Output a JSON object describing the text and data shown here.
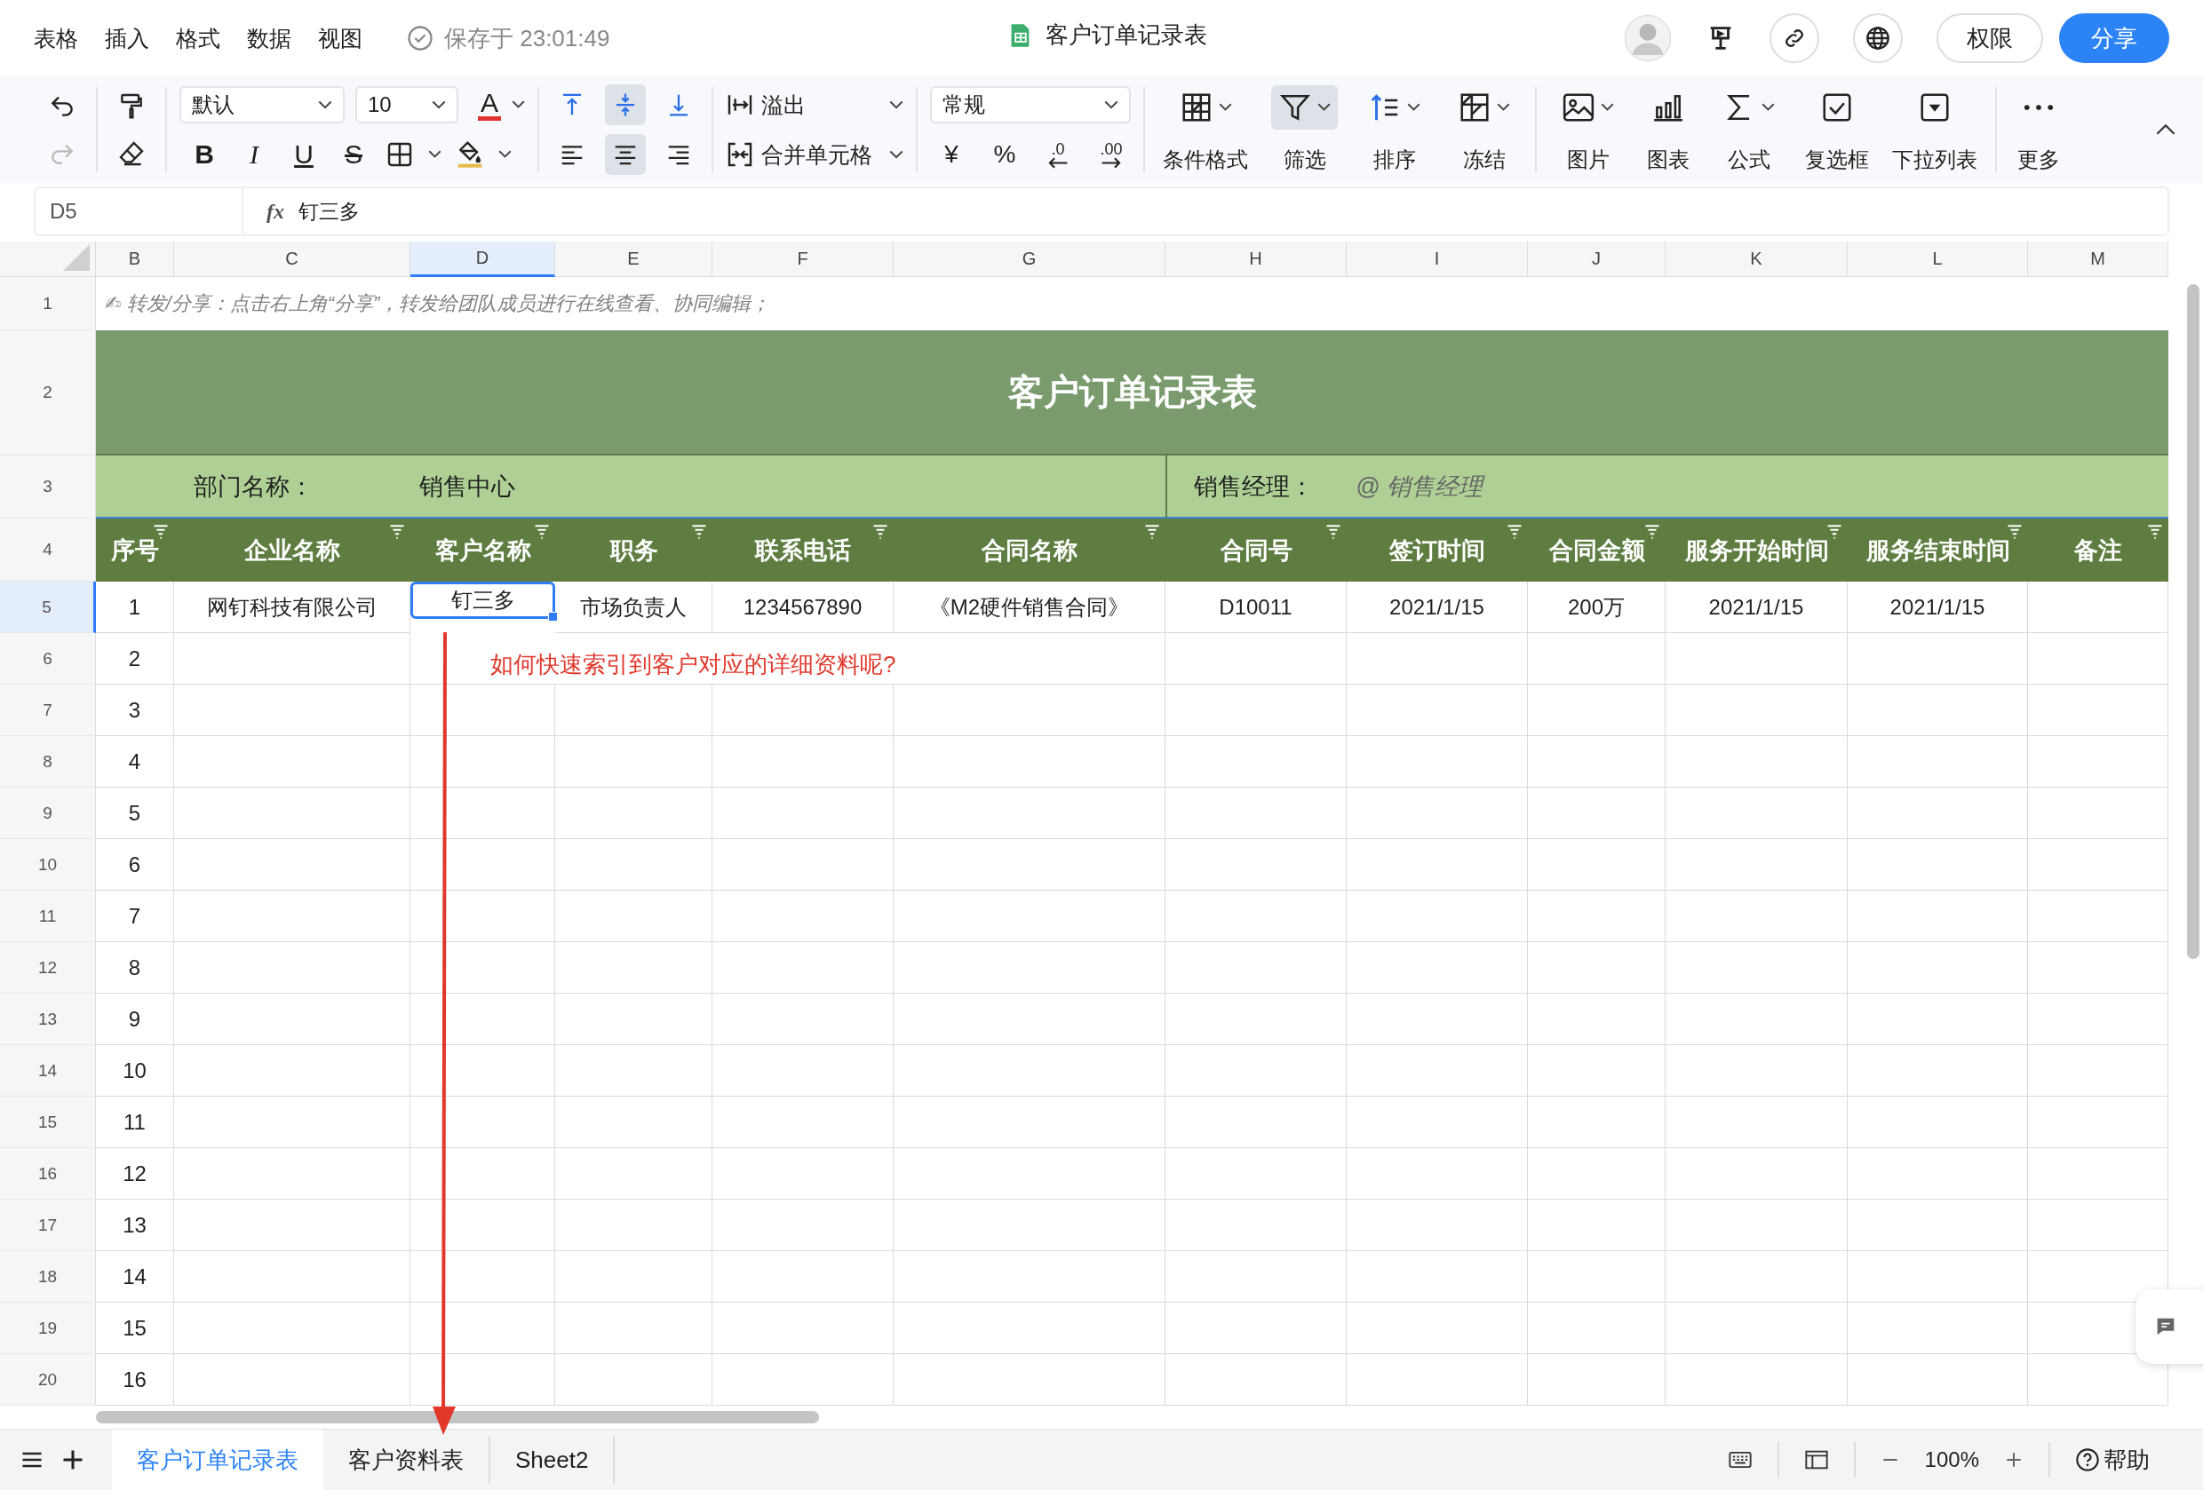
{
  "menu": [
    "表格",
    "插入",
    "格式",
    "数据",
    "视图"
  ],
  "save_status": "保存于 23:01:49",
  "doc_title": "客户订单记录表",
  "header_buttons": {
    "permission": "权限",
    "share": "分享"
  },
  "toolbar": {
    "font": "默认",
    "size": "10",
    "font_color": "A",
    "text_styles": [
      {
        "label": "B",
        "kind": "bold"
      },
      {
        "label": "I",
        "kind": "italic"
      },
      {
        "label": "U",
        "kind": "underline"
      },
      {
        "label": "S",
        "kind": "strike"
      }
    ],
    "valign": [
      {
        "kind": "top",
        "selected": false
      },
      {
        "kind": "middle",
        "selected": true
      },
      {
        "kind": "bottom",
        "selected": false
      }
    ],
    "halign": [
      {
        "kind": "left",
        "selected": false
      },
      {
        "kind": "center",
        "selected": true
      },
      {
        "kind": "right",
        "selected": false
      }
    ],
    "wrap": "溢出",
    "merge": "合并单元格",
    "number_format": "常规",
    "currency": "¥",
    "percent": "%",
    "decimal_decrease": ".0",
    "decimal_increase": ".00",
    "big_tools": [
      {
        "label": "条件格式",
        "kind": "conditional",
        "selected": false,
        "dropdown": true
      },
      {
        "label": "筛选",
        "kind": "filter",
        "selected": true,
        "dropdown": true
      },
      {
        "label": "排序",
        "kind": "sort",
        "selected": false,
        "dropdown": true
      },
      {
        "label": "冻结",
        "kind": "freeze",
        "selected": false,
        "dropdown": true
      },
      {
        "label": "图片",
        "kind": "image",
        "selected": false,
        "dropdown": true
      },
      {
        "label": "图表",
        "kind": "chart",
        "selected": false,
        "dropdown": false
      },
      {
        "label": "公式",
        "kind": "formula",
        "selected": false,
        "dropdown": true
      },
      {
        "label": "复选框",
        "kind": "checkbox",
        "selected": false,
        "dropdown": false
      },
      {
        "label": "下拉列表",
        "kind": "dropdown",
        "selected": false,
        "dropdown": false
      },
      {
        "label": "更多",
        "kind": "more",
        "selected": false,
        "dropdown": false
      }
    ]
  },
  "formula_bar": {
    "cell": "D5",
    "fx": "fx",
    "value": "钉三多"
  },
  "columns": [
    {
      "label": "B",
      "selected": false
    },
    {
      "label": "C",
      "selected": false
    },
    {
      "label": "D",
      "selected": true
    },
    {
      "label": "E",
      "selected": false
    },
    {
      "label": "F",
      "selected": false
    },
    {
      "label": "G",
      "selected": false
    },
    {
      "label": "H",
      "selected": false
    },
    {
      "label": "I",
      "selected": false
    },
    {
      "label": "J",
      "selected": false
    },
    {
      "label": "K",
      "selected": false
    },
    {
      "label": "L",
      "selected": false
    },
    {
      "label": "M",
      "selected": false
    }
  ],
  "row_headers": [
    {
      "label": "1",
      "selected": false
    },
    {
      "label": "2",
      "selected": false
    },
    {
      "label": "3",
      "selected": false
    },
    {
      "label": "4",
      "selected": false
    },
    {
      "label": "5",
      "selected": true
    },
    {
      "label": "6",
      "selected": false
    },
    {
      "label": "7",
      "selected": false
    },
    {
      "label": "8",
      "selected": false
    },
    {
      "label": "9",
      "selected": false
    },
    {
      "label": "10",
      "selected": false
    },
    {
      "label": "11",
      "selected": false
    },
    {
      "label": "12",
      "selected": false
    },
    {
      "label": "13",
      "selected": false
    },
    {
      "label": "14",
      "selected": false
    },
    {
      "label": "15",
      "selected": false
    },
    {
      "label": "16",
      "selected": false
    },
    {
      "label": "17",
      "selected": false
    },
    {
      "label": "18",
      "selected": false
    },
    {
      "label": "19",
      "selected": false
    },
    {
      "label": "20",
      "selected": false
    }
  ],
  "sheet": {
    "note": "✍ 转发/分享：点击右上角“分享”，转发给团队成员进行在线查看、协同编辑；",
    "title": "客户订单记录表",
    "dept_label": "部门名称：",
    "dept_value": "销售中心",
    "manager_label": "销售经理：",
    "manager_value": "@ 销售经理",
    "headers": [
      "序号",
      "企业名称",
      "客户名称",
      "职务",
      "联系电话",
      "合同名称",
      "合同号",
      "签订时间",
      "合同金额",
      "服务开始时间",
      "服务结束时间",
      "备注"
    ],
    "rows": [
      [
        "1",
        "网钉科技有限公司",
        "钉三多",
        "市场负责人",
        "1234567890",
        "《M2硬件销售合同》",
        "D10011",
        "2021/1/15",
        "200万",
        "2021/1/15",
        "2021/1/15"
      ],
      [
        "2"
      ],
      [
        "3"
      ],
      [
        "4"
      ],
      [
        "5"
      ],
      [
        "6"
      ],
      [
        "7"
      ],
      [
        "8"
      ],
      [
        "9"
      ],
      [
        "10"
      ],
      [
        "11"
      ],
      [
        "12"
      ],
      [
        "13"
      ],
      [
        "14"
      ],
      [
        "15"
      ],
      [
        "16"
      ]
    ]
  },
  "annotation": "如何快速索引到客户对应的详细资料呢?",
  "sheet_tabs": [
    {
      "label": "客户订单记录表",
      "selected": true
    },
    {
      "label": "客户资料表",
      "selected": false
    },
    {
      "label": "Sheet2",
      "selected": false
    }
  ],
  "zoom": "100%",
  "help": "帮助"
}
